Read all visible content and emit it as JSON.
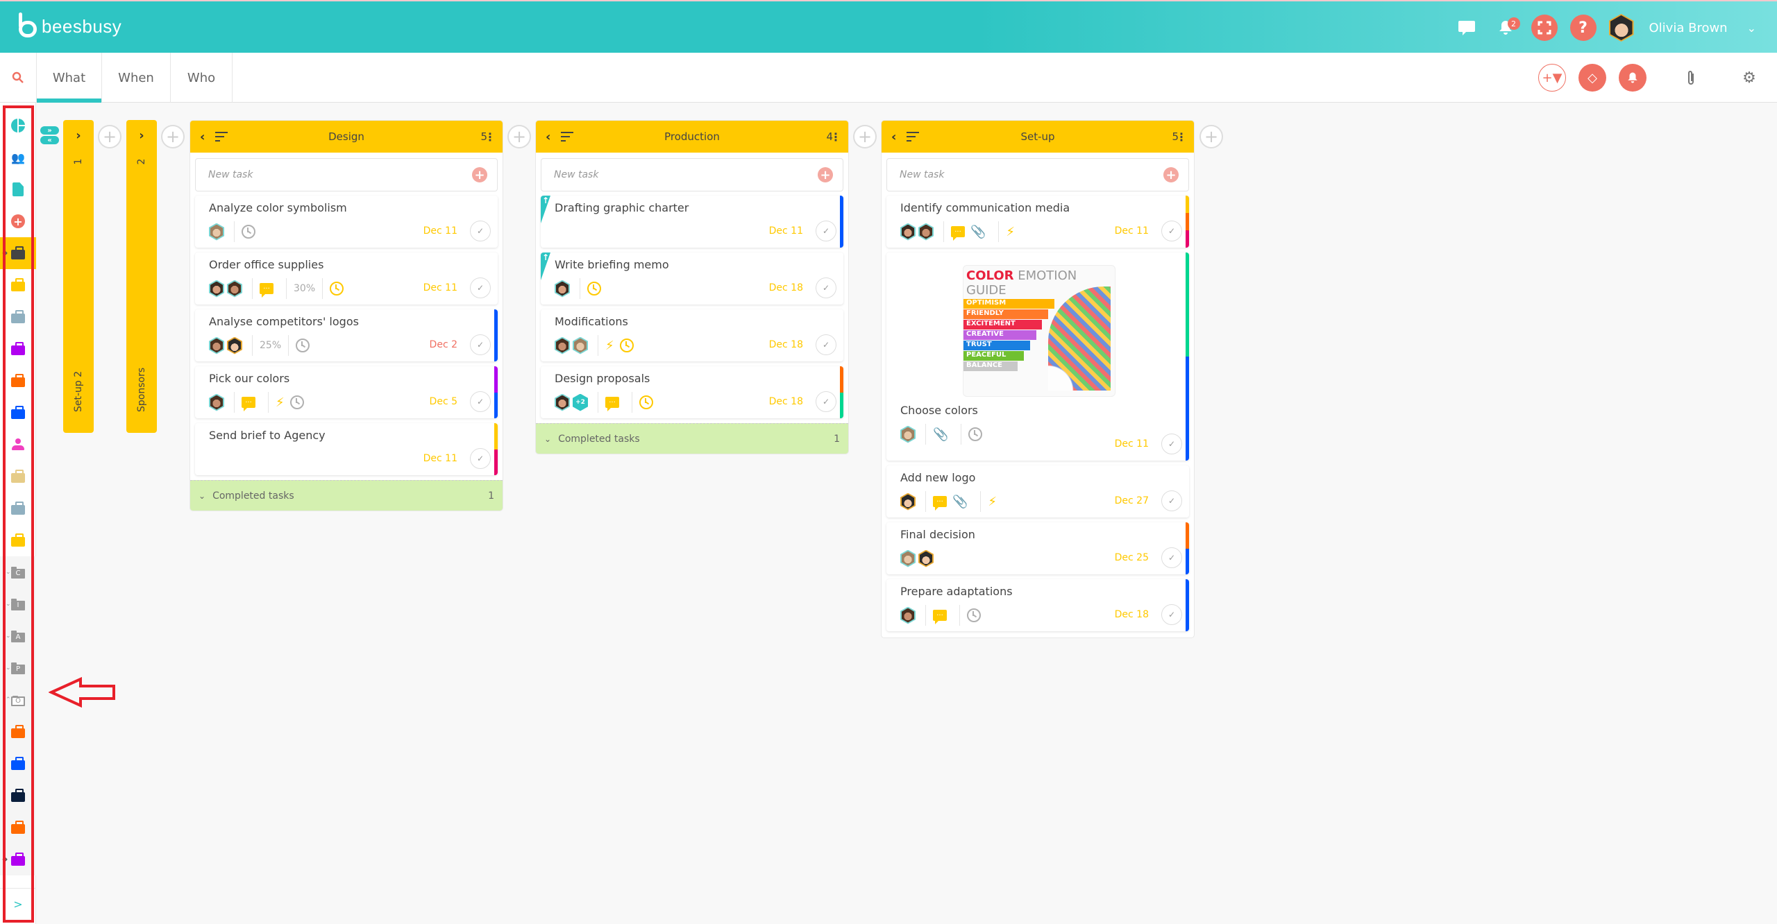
{
  "app": {
    "logo_text": "beesbusy",
    "notification_count": "2",
    "user_name": "Olivia Brown",
    "brand_color": "#2ec5c3",
    "accent_color": "#f07062",
    "column_color": "#ffc900"
  },
  "topbar_icons": {
    "chat": "chat-icon",
    "notifications": "bell-icon",
    "fullscreen": "fullscreen-icon",
    "help": "help-icon",
    "help_glyph": "?"
  },
  "tabs": [
    {
      "label": "What",
      "active": true
    },
    {
      "label": "When",
      "active": false
    },
    {
      "label": "Who",
      "active": false
    }
  ],
  "toolbar": {
    "filter": "add-filter-icon",
    "tags": "tag-icon",
    "reminders": "bell-icon",
    "attachments": "paperclip-icon",
    "settings": "gear-icon"
  },
  "sidebar": {
    "items": [
      {
        "icon": "dashboard-icon",
        "color": "#2ec5c3"
      },
      {
        "icon": "people-icon",
        "color": "#2ec5c3"
      },
      {
        "icon": "document-icon",
        "color": "#2ec5c3"
      },
      {
        "icon": "add-project-icon",
        "color": "#f07062"
      },
      {
        "icon": "briefcase-icon",
        "color": "#444444",
        "active": true
      },
      {
        "icon": "briefcase-icon",
        "color": "#ffc900"
      },
      {
        "icon": "briefcase-icon",
        "color": "#90b0c0"
      },
      {
        "icon": "briefcase-icon",
        "color": "#b000f0"
      },
      {
        "icon": "briefcase-icon",
        "color": "#ff6a00"
      },
      {
        "icon": "briefcase-icon",
        "color": "#0055ff"
      },
      {
        "icon": "person-icon",
        "color": "#f040c0"
      },
      {
        "icon": "briefcase-icon",
        "color": "#e6cc88"
      },
      {
        "icon": "briefcase-icon",
        "color": "#90b0c0"
      },
      {
        "icon": "briefcase-icon",
        "color": "#ffc900"
      },
      {
        "icon": "folder-icon",
        "letter": "C"
      },
      {
        "icon": "folder-icon",
        "letter": "I"
      },
      {
        "icon": "folder-icon",
        "letter": "A"
      },
      {
        "icon": "folder-icon",
        "letter": "P"
      },
      {
        "icon": "folder-open-icon",
        "letter": "O"
      },
      {
        "icon": "briefcase-icon",
        "color": "#ff6a00"
      },
      {
        "icon": "briefcase-icon",
        "color": "#0055ff"
      },
      {
        "icon": "briefcase-icon",
        "color": "#0a1e3c"
      },
      {
        "icon": "briefcase-icon",
        "color": "#ff6a00"
      },
      {
        "icon": "briefcase-icon",
        "color": "#b000f0"
      }
    ],
    "expand_glyph": ">"
  },
  "board": {
    "collapsed_columns": [
      {
        "number": "1",
        "label": "Set-up 2"
      },
      {
        "number": "2",
        "label": "Sponsors"
      }
    ],
    "new_task_placeholder": "New task",
    "completed_label": "Completed tasks",
    "columns": [
      {
        "title": "Design",
        "count": "5",
        "completed_count": "1",
        "tasks": [
          {
            "title": "Analyze color symbolism",
            "due": "Dec 11",
            "due_color": "#ffc900",
            "stripes": []
          },
          {
            "title": "Order office supplies",
            "due": "Dec 11",
            "due_color": "#ffc900",
            "progress": "30%",
            "stripes": []
          },
          {
            "title": "Analyse competitors' logos",
            "due": "Dec 2",
            "due_color": "#f07062",
            "progress": "25%",
            "stripes": [
              "#0055ff"
            ]
          },
          {
            "title": "Pick our colors",
            "due": "Dec 5",
            "due_color": "#ffc900",
            "stripes": [
              "#b000f0",
              "#0055ff"
            ]
          },
          {
            "title": "Send brief to Agency",
            "due": "Dec 11",
            "due_color": "#ffc900",
            "stripes": [
              "#ffc900",
              "#e8006a"
            ]
          }
        ]
      },
      {
        "title": "Production",
        "count": "4",
        "completed_count": "1",
        "tasks": [
          {
            "title": "Drafting graphic charter",
            "due": "Dec 11",
            "due_color": "#ffc900",
            "stripes": [
              "#0055ff"
            ],
            "priority": true
          },
          {
            "title": "Write briefing memo",
            "due": "Dec 18",
            "due_color": "#ffc900",
            "stripes": [],
            "priority": true
          },
          {
            "title": "Modifications",
            "due": "Dec 18",
            "due_color": "#ffc900",
            "stripes": []
          },
          {
            "title": "Design proposals",
            "due": "Dec 18",
            "due_color": "#ffc900",
            "extra_members": "+2",
            "stripes": [
              "#ff6a00",
              "#00d68f"
            ]
          }
        ]
      },
      {
        "title": "Set-up",
        "count": "5",
        "tasks": [
          {
            "title": "Identify communication media",
            "due": "Dec 11",
            "due_color": "#ffc900",
            "stripes": [
              "#ffc900",
              "#ff6a00",
              "#e8006a"
            ]
          },
          {
            "title": "Choose colors",
            "due": "Dec 11",
            "due_color": "#ffc900",
            "stripes": [
              "#00d68f",
              "#0055ff"
            ],
            "cover": {
              "title_a": "COLOR",
              "title_b": " EMOTION GUIDE",
              "rows": [
                "OPTIMISM",
                "FRIENDLY",
                "EXCITEMENT",
                "CREATIVE",
                "TRUST",
                "PEACEFUL",
                "BALANCE"
              ]
            }
          },
          {
            "title": "Add new logo",
            "due": "Dec 27",
            "due_color": "#ffc900",
            "stripes": []
          },
          {
            "title": "Final decision",
            "due": "Dec 25",
            "due_color": "#ffc900",
            "stripes": [
              "#ff6a00",
              "#0055ff"
            ]
          },
          {
            "title": "Prepare adaptations",
            "due": "Dec 18",
            "due_color": "#ffc900",
            "stripes": [
              "#0055ff"
            ]
          }
        ]
      }
    ]
  }
}
